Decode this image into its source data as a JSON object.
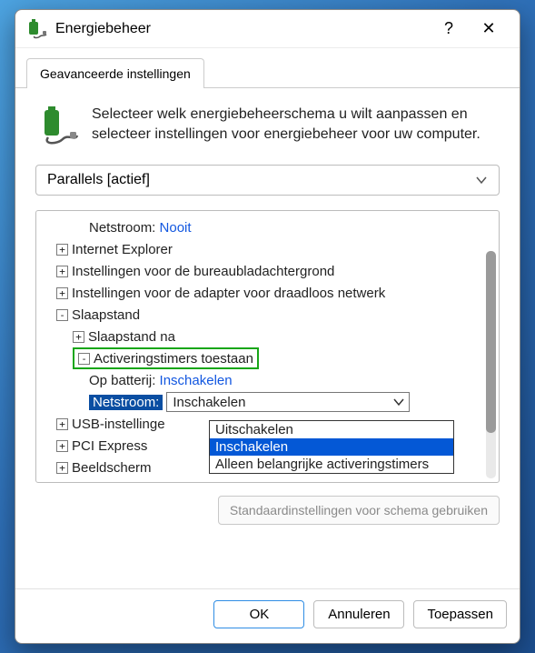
{
  "window": {
    "title": "Energiebeheer",
    "help_icon": "?",
    "close_icon": "✕"
  },
  "tabs": {
    "advanced": "Geavanceerde instellingen"
  },
  "intro": {
    "text": "Selecteer welk energiebeheerschema u wilt aanpassen en selecteer instellingen voor energiebeheer voor uw computer."
  },
  "scheme": {
    "selected": "Parallels [actief]"
  },
  "tree": {
    "netstroom_label": "Netstroom:",
    "netstroom_value": "Nooit",
    "ie": "Internet Explorer",
    "desktop_bg": "Instellingen voor de bureaubladachtergrond",
    "wireless": "Instellingen voor de adapter voor draadloos netwerk",
    "sleep": "Slaapstand",
    "sleep_after": "Slaapstand na",
    "wake_timers": "Activeringstimers toestaan",
    "on_battery_label": "Op batterij:",
    "on_battery_value": "Inschakelen",
    "on_ac_label": "Netstroom:",
    "on_ac_value": "Inschakelen",
    "usb": "USB-instellinge",
    "pci": "PCI Express",
    "display": "Beeldscherm"
  },
  "dropdown": {
    "options": [
      "Uitschakelen",
      "Inschakelen",
      "Alleen belangrijke activeringstimers"
    ],
    "opt0": "Uitschakelen",
    "opt1": "Inschakelen",
    "opt2": "Alleen belangrijke activeringstimers"
  },
  "defaults_button": "Standaardinstellingen voor schema gebruiken",
  "footer": {
    "ok": "OK",
    "cancel": "Annuleren",
    "apply": "Toepassen"
  }
}
